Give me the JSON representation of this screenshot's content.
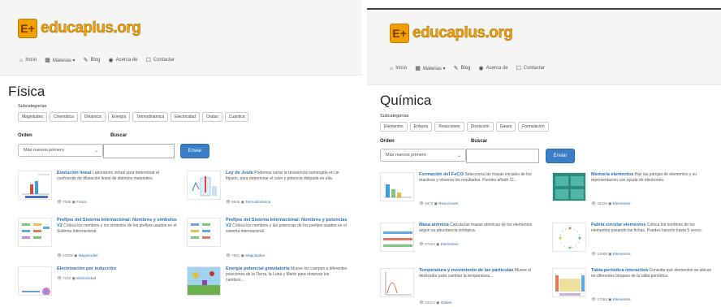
{
  "site": {
    "logo_badge": "E+",
    "logo_text": "educaplus.org"
  },
  "nav": [
    {
      "icon": "⌂",
      "label": "Inicio"
    },
    {
      "icon": "▦",
      "label": "Materias ▾"
    },
    {
      "icon": "✎",
      "label": "Blog"
    },
    {
      "icon": "◉",
      "label": "Acerca de"
    },
    {
      "icon": "☐",
      "label": "Contactar"
    }
  ],
  "left": {
    "title": "Física",
    "subcategories_label": "Subcategorías",
    "subcategories": [
      "Magnitudes",
      "Cinemática",
      "Dinámica",
      "Energía",
      "Termodinámica",
      "Electricidad",
      "Ondas",
      "Cuántica"
    ],
    "order_label": "Orden",
    "search_label": "Buscar",
    "order_value": "Más nuevos primero",
    "send_label": "Enviar",
    "cards": [
      {
        "title": "Evolución lineal",
        "desc": "Laboratorio virtual para determinar el coeficiente de dilatación lineal de distintos materiales.",
        "views": "7068",
        "cat": "Física"
      },
      {
        "title": "Ley de Joule",
        "desc": "Podemos variar la resistencia sumergida en un líquido, para determinar el calor y potencia disipada en ella.",
        "views": "5848",
        "cat": "Termodinámica"
      },
      {
        "title": "Prefijos del Sistema Internacional: Nombres y símbolos V2",
        "desc": "Coloca los nombres y los símbolos de los prefijos usados en el Sistema Internacional.",
        "views": "10539",
        "cat": "Magnitudes"
      },
      {
        "title": "Prefijos del Sistema Internacional: Nombres y potencias V2",
        "desc": "Coloca los nombres y las potencias de los prefijos usados en el sistema internacional.",
        "views": "7891",
        "cat": "Magnitudes"
      },
      {
        "title": "Electrización por inducción",
        "desc": "",
        "views": "7152",
        "cat": "Electricidad"
      },
      {
        "title": "Energía potencial gravitatoria",
        "desc": "Mueve los cuerpos a diferentes posiciones de la Tierra, la Luna y Marte para observar los cambios...",
        "views": "",
        "cat": ""
      }
    ]
  },
  "right": {
    "title": "Química",
    "subcategories_label": "Subcategorías",
    "subcategories": [
      "Elementos",
      "Enlaces",
      "Reacciones",
      "Disolución",
      "Gases",
      "Formulación"
    ],
    "order_label": "Orden",
    "search_label": "Buscar",
    "order_value": "Más nuevos primero",
    "send_label": "Enviar",
    "cards": [
      {
        "title": "Formación del FeCl3",
        "desc": "Selecciona las masas iniciales de los reactivos y observa los resultados. Puedes añadir Cl...",
        "views": "4673",
        "cat": "Reacciones"
      },
      {
        "title": "Memoria elementos",
        "desc": "Haz las parejas de elementos y su representación con ayuda de electrones.",
        "views": "19325",
        "cat": "Elementos"
      },
      {
        "title": "Masa atómica",
        "desc": "Calcula las masas atómicas de los elementos según su abundancia isotópica.",
        "views": "27044",
        "cat": "Elementos"
      },
      {
        "title": "Paleta circular elementos",
        "desc": "Coloca los nombres de los elementos pasando las fichas. Puedes hacerlo hasta 5 veces.",
        "views": "14968",
        "cat": "Elementos"
      },
      {
        "title": "Temperatura y movimiento de las partículas",
        "desc": "Mueve el deslizador para cambiar la temperatura...",
        "views": "22212",
        "cat": "Gases"
      },
      {
        "title": "Tabla periódica interactiva",
        "desc": "Consulta qué elementos se ubican en diferentes bloques de la tabla periódica.",
        "views": "17052",
        "cat": "Elementos"
      }
    ]
  }
}
